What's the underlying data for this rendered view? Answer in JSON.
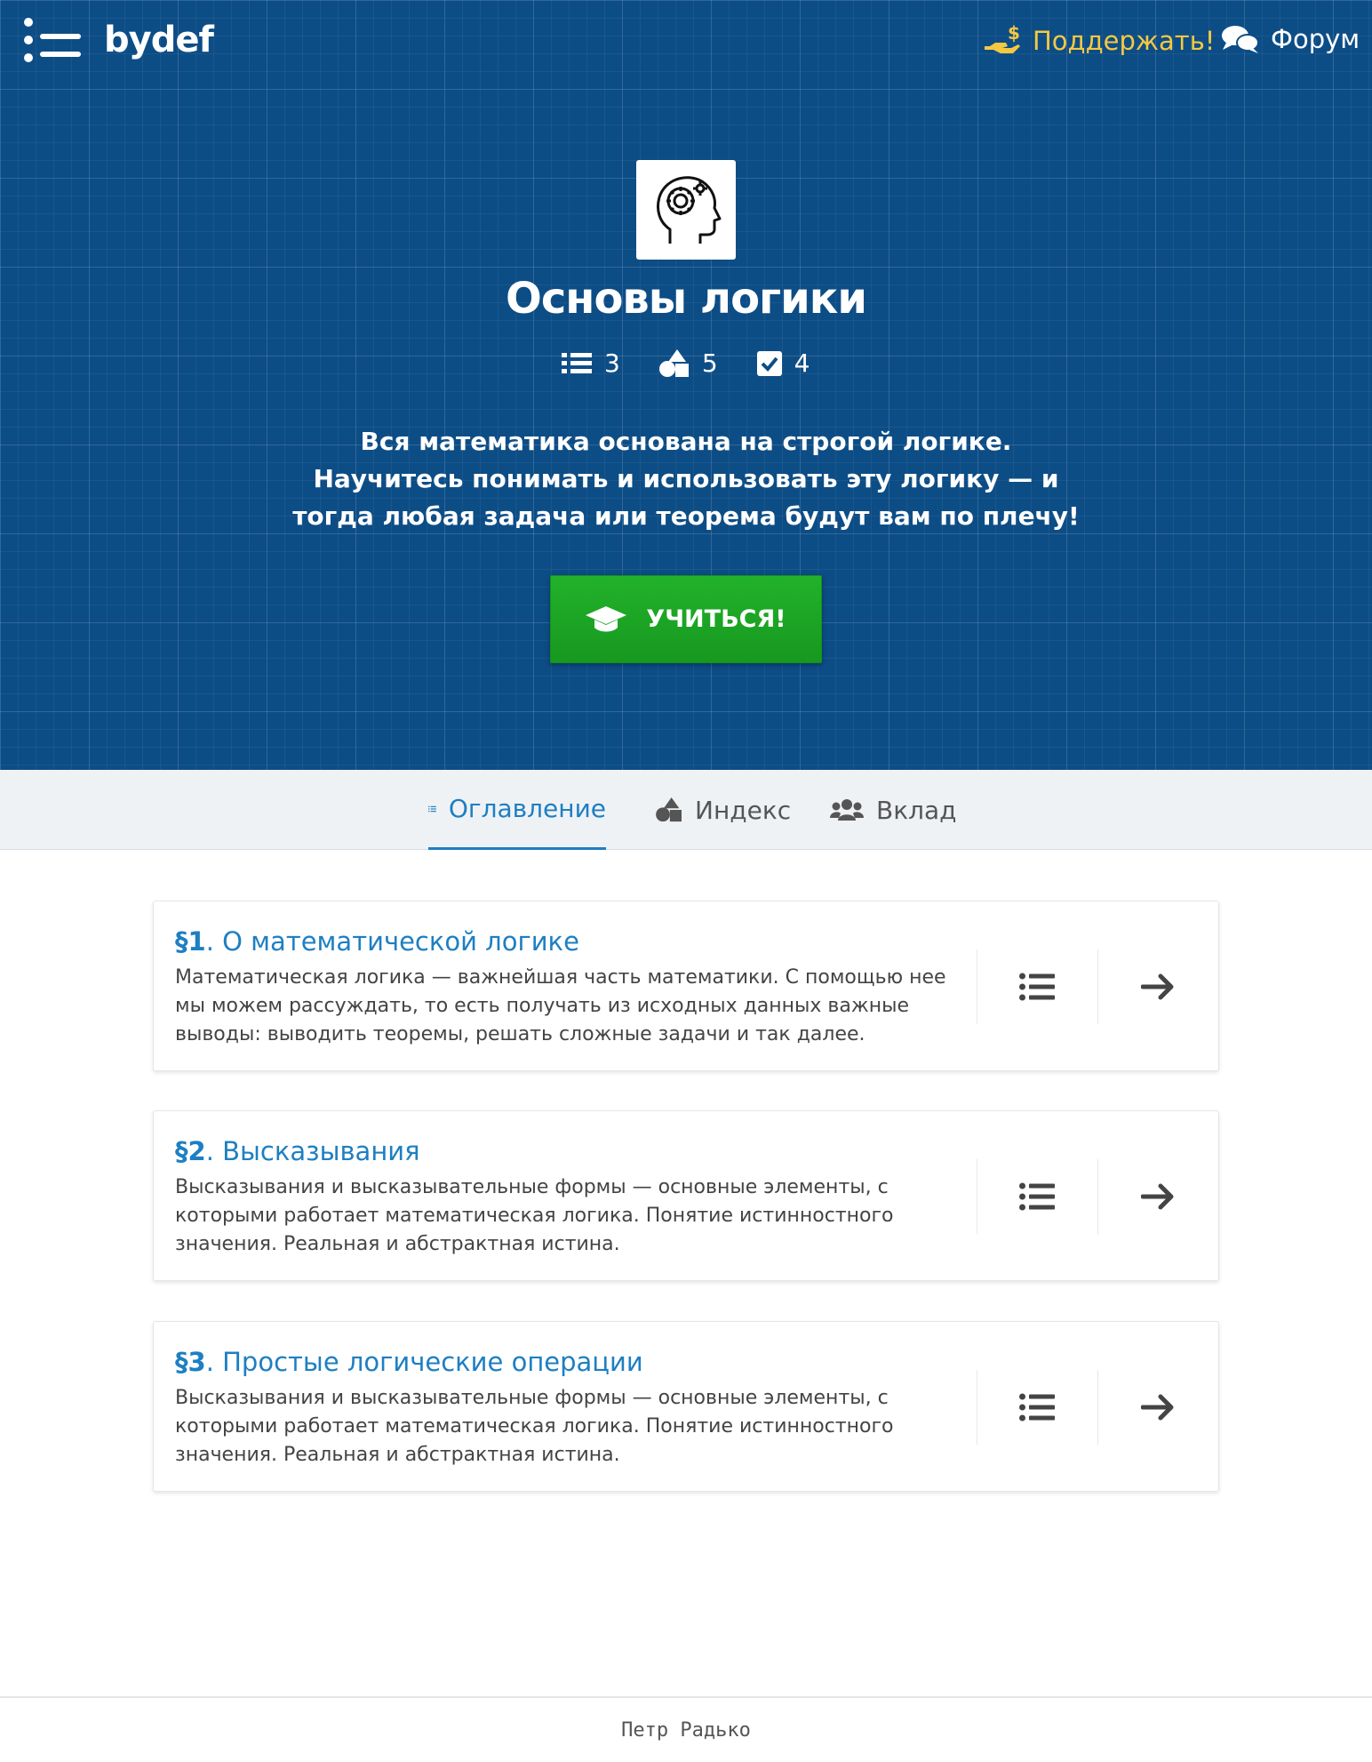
{
  "header": {
    "logo_text": "bydef",
    "support_label": "Поддержать!",
    "forum_label": "Форум"
  },
  "course": {
    "icon": "head-gear-icon",
    "title": "Основы логики",
    "stats": {
      "sections": "3",
      "definitions": "5",
      "exercises": "4"
    },
    "description": "Вся математика основана на строгой логике. Научитесь понимать и использовать эту логику — и тогда любая задача или теорема будут вам по плечу!",
    "learn_button": "УЧИТЬСЯ!"
  },
  "tabs": [
    {
      "label": "Оглавление",
      "icon": "list-icon",
      "active": true
    },
    {
      "label": "Индекс",
      "icon": "shapes-icon",
      "active": false
    },
    {
      "label": "Вклад",
      "icon": "users-icon",
      "active": false
    }
  ],
  "sections": [
    {
      "number": "§1",
      "title": ". О математической логике",
      "text": "Математическая логика — важнейшая часть математики. С помощью нее мы можем рассуждать, то есть получать из исходных данных важные выводы: выводить теоремы, решать сложные задачи и так далее."
    },
    {
      "number": "§2",
      "title": ". Высказывания",
      "text": "Высказывания и высказывательные формы — основные элементы, с которыми работает математическая логика. Понятие истинностного значения. Реальная и абстрактная истина."
    },
    {
      "number": "§3",
      "title": ". Простые логические операции",
      "text": "Высказывания и высказывательные формы — основные элементы, с которыми работает математическая логика. Понятие истинностного значения. Реальная и абстрактная истина."
    }
  ],
  "footer": {
    "author": "Петр Радько"
  },
  "colors": {
    "hero_bg": "#0d4d86",
    "accent": "#1e7fc2",
    "button_green": "#1aa523",
    "support_yellow": "#f5c842"
  }
}
